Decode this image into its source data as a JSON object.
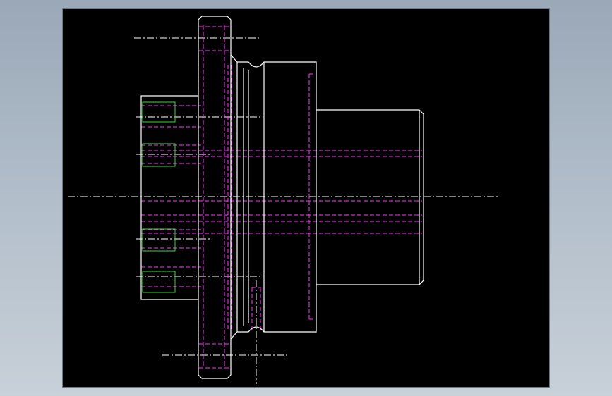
{
  "drawing": {
    "background_color": "#000000",
    "outline_color": "#ffffff",
    "hidden_line_color": "#ff33ff",
    "thread_color": "#33dd33",
    "centerline_color": "#ffffff",
    "frame_color": "#b4c0cc"
  }
}
